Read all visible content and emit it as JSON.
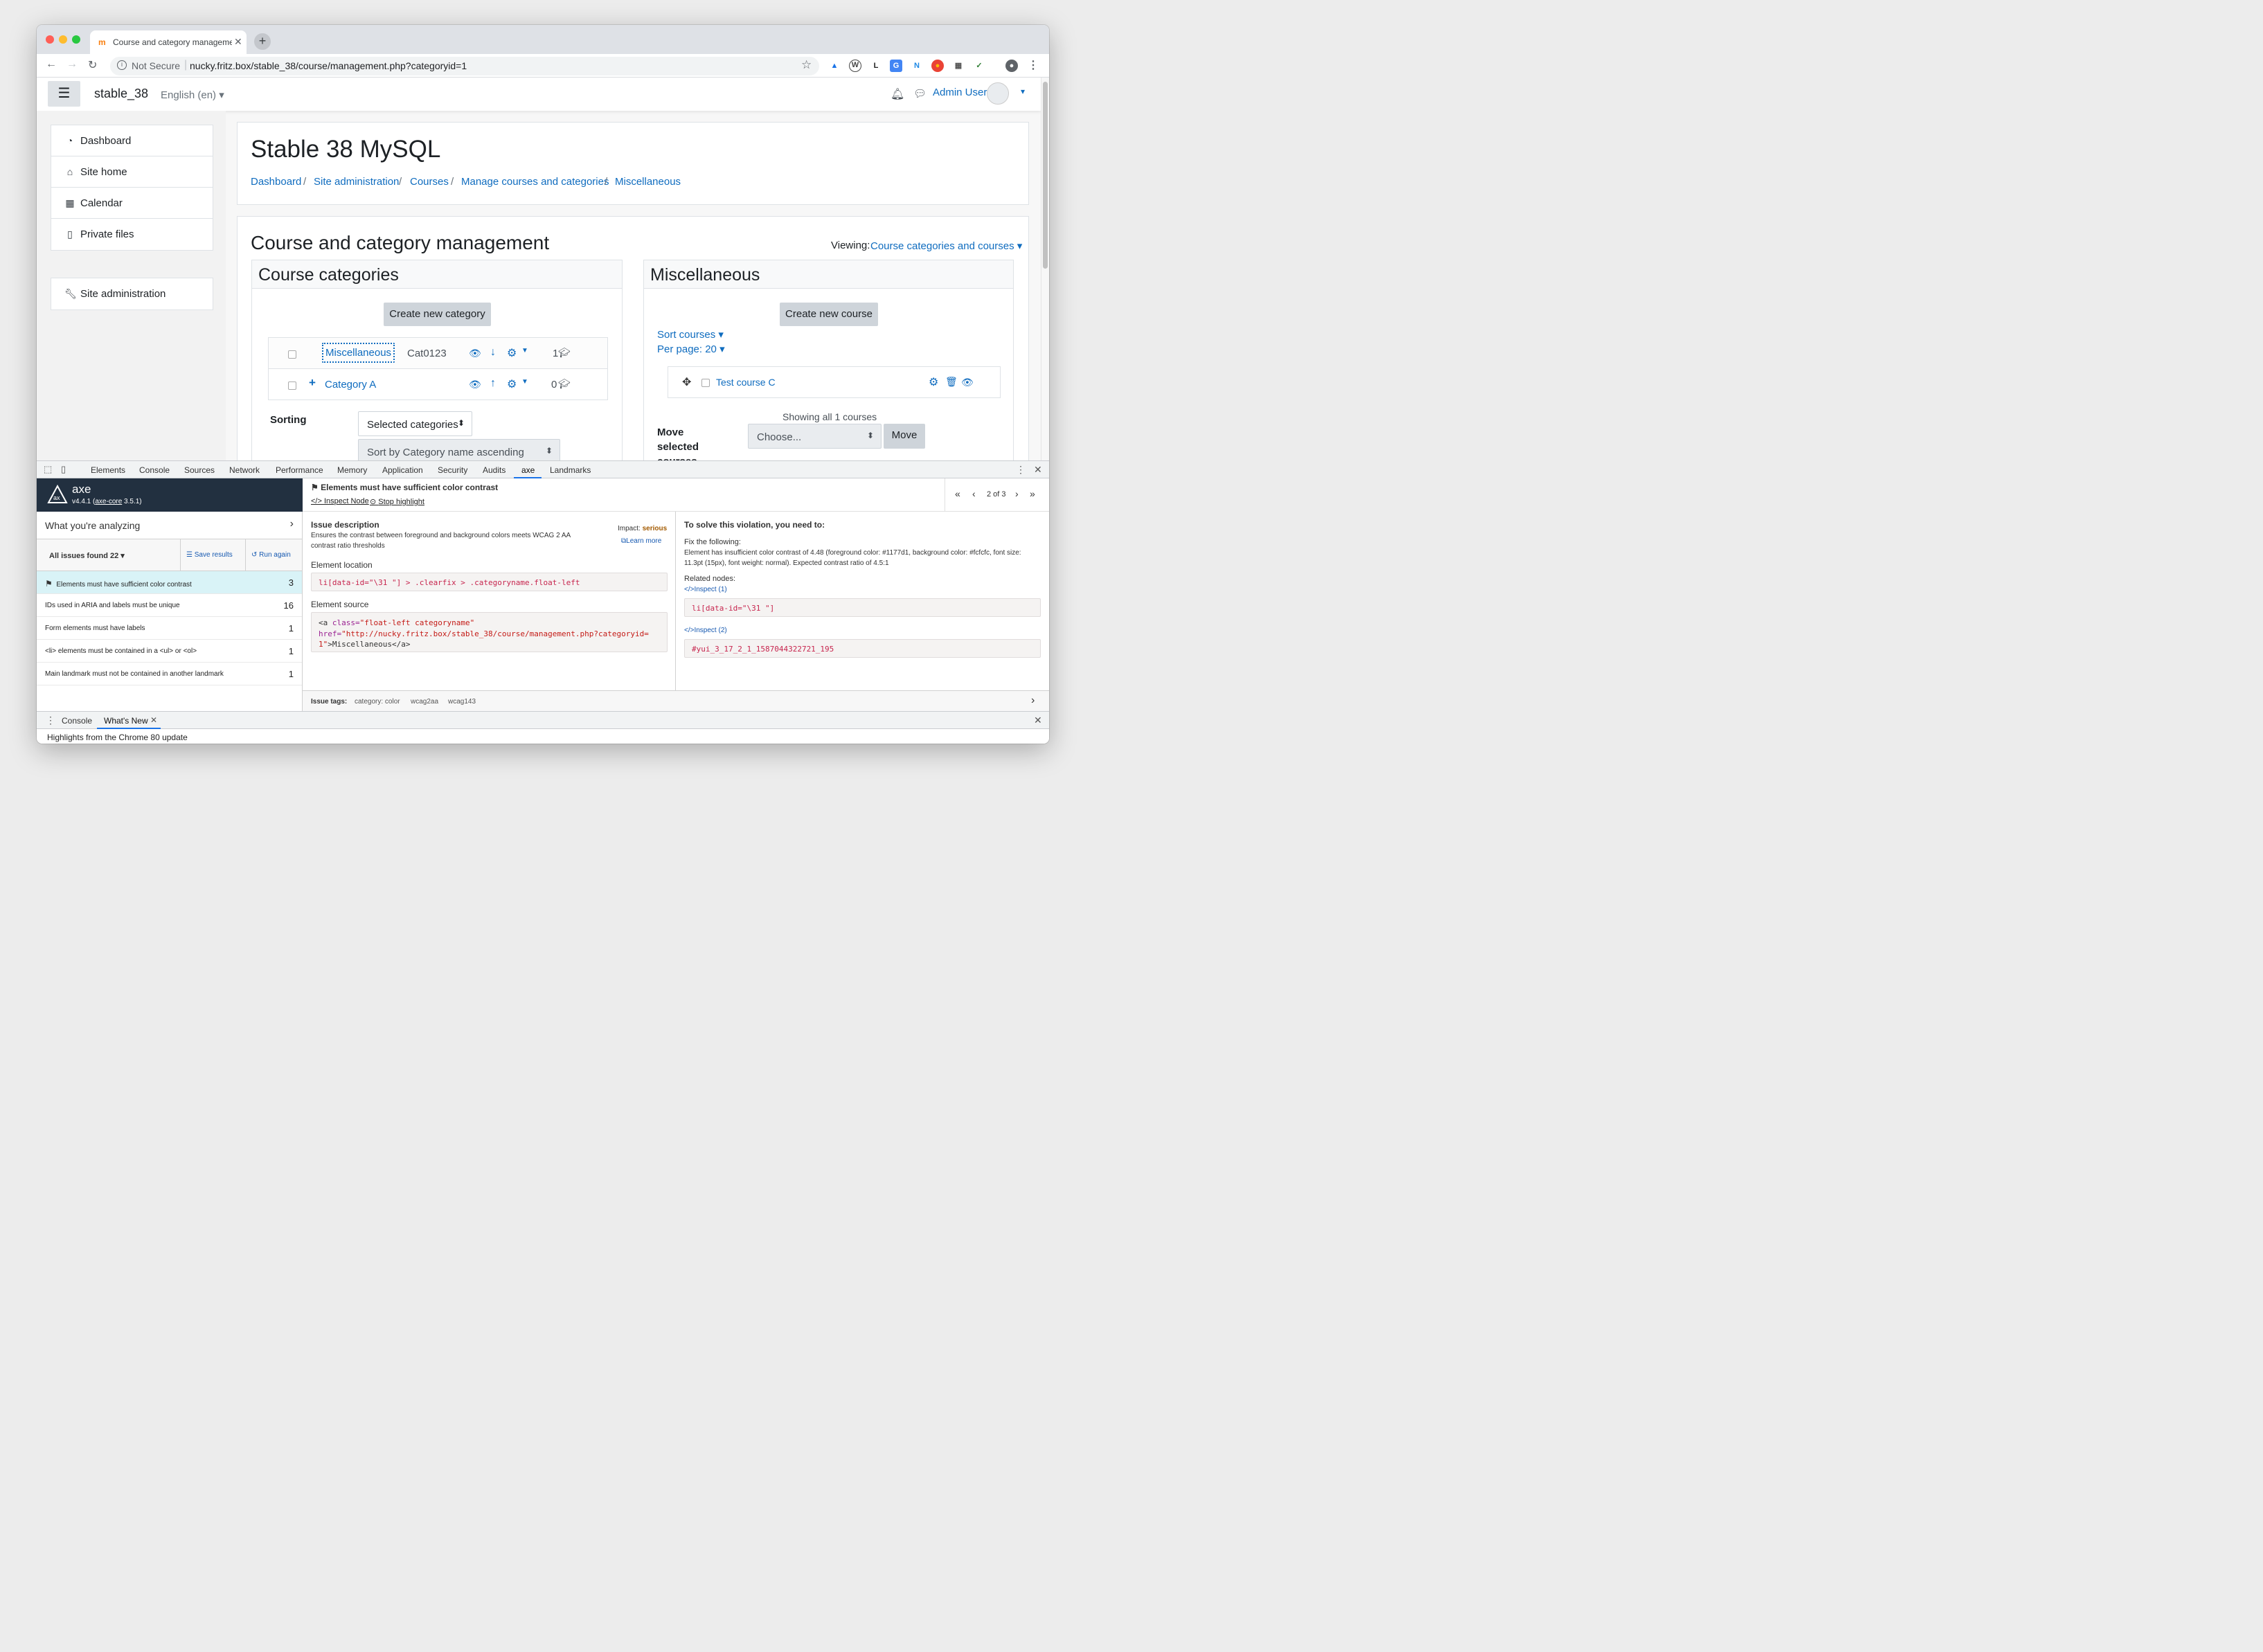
{
  "browser": {
    "tab_title": "Course and category management",
    "not_secure": "Not Secure",
    "url": "nucky.fritz.box/stable_38/course/management.php?categoryid=1"
  },
  "site": {
    "brand": "stable_38",
    "language": "English (en)",
    "user": "Admin User"
  },
  "sidebar": {
    "items": [
      {
        "label": "Dashboard",
        "icon": "dashboard-icon"
      },
      {
        "label": "Site home",
        "icon": "home-icon"
      },
      {
        "label": "Calendar",
        "icon": "calendar-icon"
      },
      {
        "label": "Private files",
        "icon": "file-icon"
      },
      {
        "label": "Site administration",
        "icon": "wrench-icon"
      }
    ]
  },
  "header": {
    "title": "Stable 38 MySQL",
    "breadcrumb": [
      "Dashboard",
      "Site administration",
      "Courses",
      "Manage courses and categories",
      "Miscellaneous"
    ]
  },
  "management": {
    "title": "Course and category management",
    "viewing_label": "Viewing:",
    "viewing_value": "Course categories and courses",
    "categories": {
      "heading": "Course categories",
      "create_button": "Create new category",
      "rows": [
        {
          "name": "Miscellaneous",
          "idnumber": "Cat0123",
          "count": "1"
        },
        {
          "name": "Category A",
          "idnumber": "",
          "count": "0"
        }
      ],
      "sorting_label": "Sorting",
      "sort_target": "Selected categories",
      "sort_by": "Sort by Category name ascending"
    },
    "courses": {
      "heading": "Miscellaneous",
      "create_button": "Create new course",
      "sort_courses": "Sort courses",
      "per_page": "Per page: 20",
      "course": "Test course C",
      "showing": "Showing all 1 courses",
      "move_label_1": "Move",
      "move_label_2": "selected",
      "move_label_3": "courses",
      "choose": "Choose...",
      "move_button": "Move"
    }
  },
  "devtools": {
    "tabs": [
      "Elements",
      "Console",
      "Sources",
      "Network",
      "Performance",
      "Memory",
      "Application",
      "Security",
      "Audits",
      "axe",
      "Landmarks"
    ],
    "active_tab": "axe",
    "axe": {
      "name": "axe",
      "version": "v4.4.1",
      "core": "axe-core",
      "core_version": "3.5.1",
      "analyzing": "What you're analyzing",
      "all_issues": "All issues found 22",
      "save": "Save results",
      "run": "Run again",
      "issues": [
        {
          "label": "Elements must have sufficient color contrast",
          "count": "3"
        },
        {
          "label": "IDs used in ARIA and labels must be unique",
          "count": "16"
        },
        {
          "label": "Form elements must have labels",
          "count": "1"
        },
        {
          "label": "<li> elements must be contained in a <ul> or <ol>",
          "count": "1"
        },
        {
          "label": "Main landmark must not be contained in another landmark",
          "count": "1"
        }
      ],
      "issue_title": "Elements must have sufficient color contrast",
      "inspect_node": "Inspect Node",
      "stop_highlight": "Stop highlight",
      "pager": "2 of 3",
      "issue_description_h": "Issue description",
      "issue_description": "Ensures the contrast between foreground and background colors meets WCAG 2 AA contrast ratio thresholds",
      "impact_label": "Impact:",
      "impact": "serious",
      "learn_more": "Learn more",
      "element_location_h": "Element location",
      "element_location": "li[data-id=\"\\31 \"] > .clearfix > .categoryname.float-left",
      "element_source_h": "Element source",
      "src_tag_open": "<a",
      "src_attr1": "class=",
      "src_val1": "\"float-left categoryname\"",
      "src_attr2": "href=",
      "src_val2": "\"http://nucky.fritz.box/stable_38/course/management.php?categoryid=1\"",
      "src_text": ">Miscellaneous</",
      "src_tag_close": "a>",
      "solve_h": "To solve this violation, you need to:",
      "fix_h": "Fix the following:",
      "fix_text": "Element has insufficient color contrast of 4.48 (foreground color: #1177d1, background color: #fcfcfc, font size: 11.3pt (15px), font weight: normal). Expected contrast ratio of 4.5:1",
      "related_h": "Related nodes:",
      "inspect_1": "Inspect (1)",
      "node_1": "li[data-id=\"\\31 \"]",
      "inspect_2": "Inspect (2)",
      "node_2": "#yui_3_17_2_1_1587044322721_195",
      "tags_label": "Issue tags:",
      "tags": [
        "category: color",
        "wcag2aa",
        "wcag143"
      ]
    },
    "drawer_tabs": [
      "Console",
      "What's New"
    ],
    "drawer_text": "Highlights from the Chrome 80 update"
  },
  "colors": {
    "link": "#0f6cbf",
    "axe_header": "#223040",
    "selected_issue": "#d9f3f7",
    "impact": "#a35a00"
  }
}
